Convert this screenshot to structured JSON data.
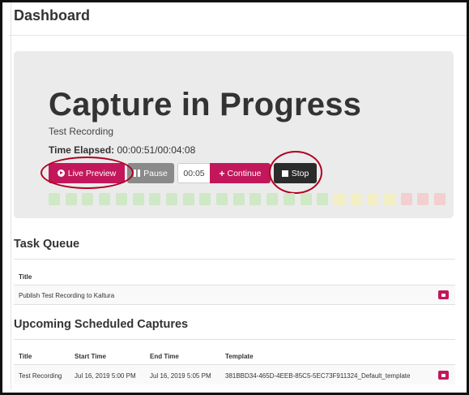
{
  "page": {
    "title": "Dashboard"
  },
  "capture": {
    "heading": "Capture in Progress",
    "recording_name": "Test Recording",
    "elapsed_label": "Time Elapsed:",
    "elapsed_value": "00:00:51/00:04:08",
    "buttons": {
      "live_preview": "Live Preview",
      "pause": "Pause",
      "duration": "00:05",
      "continue": "Continue",
      "stop": "Stop"
    },
    "meter": {
      "segments": 24,
      "colors": {
        "green": "#cfe8c5",
        "yellow": "#f3efc4",
        "red": "#f3cfcf"
      }
    }
  },
  "task_queue": {
    "title": "Task Queue",
    "columns": [
      "Title"
    ],
    "rows": [
      {
        "title": "Publish Test Recording to Kaltura"
      }
    ]
  },
  "scheduled": {
    "title": "Upcoming Scheduled Captures",
    "columns": [
      "Title",
      "Start Time",
      "End Time",
      "Template"
    ],
    "rows": [
      {
        "title": "Test Recording",
        "start": "Jul 16, 2019 5:00 PM",
        "end": "Jul 16, 2019 5:05 PM",
        "template": "381BBD34-465D-4EEB-85C5-5EC73F911324_Default_template"
      }
    ]
  },
  "colors": {
    "accent": "#c2185b",
    "stop": "#2b2b2b",
    "pause": "#8a8a8a",
    "highlight": "#b00020"
  }
}
